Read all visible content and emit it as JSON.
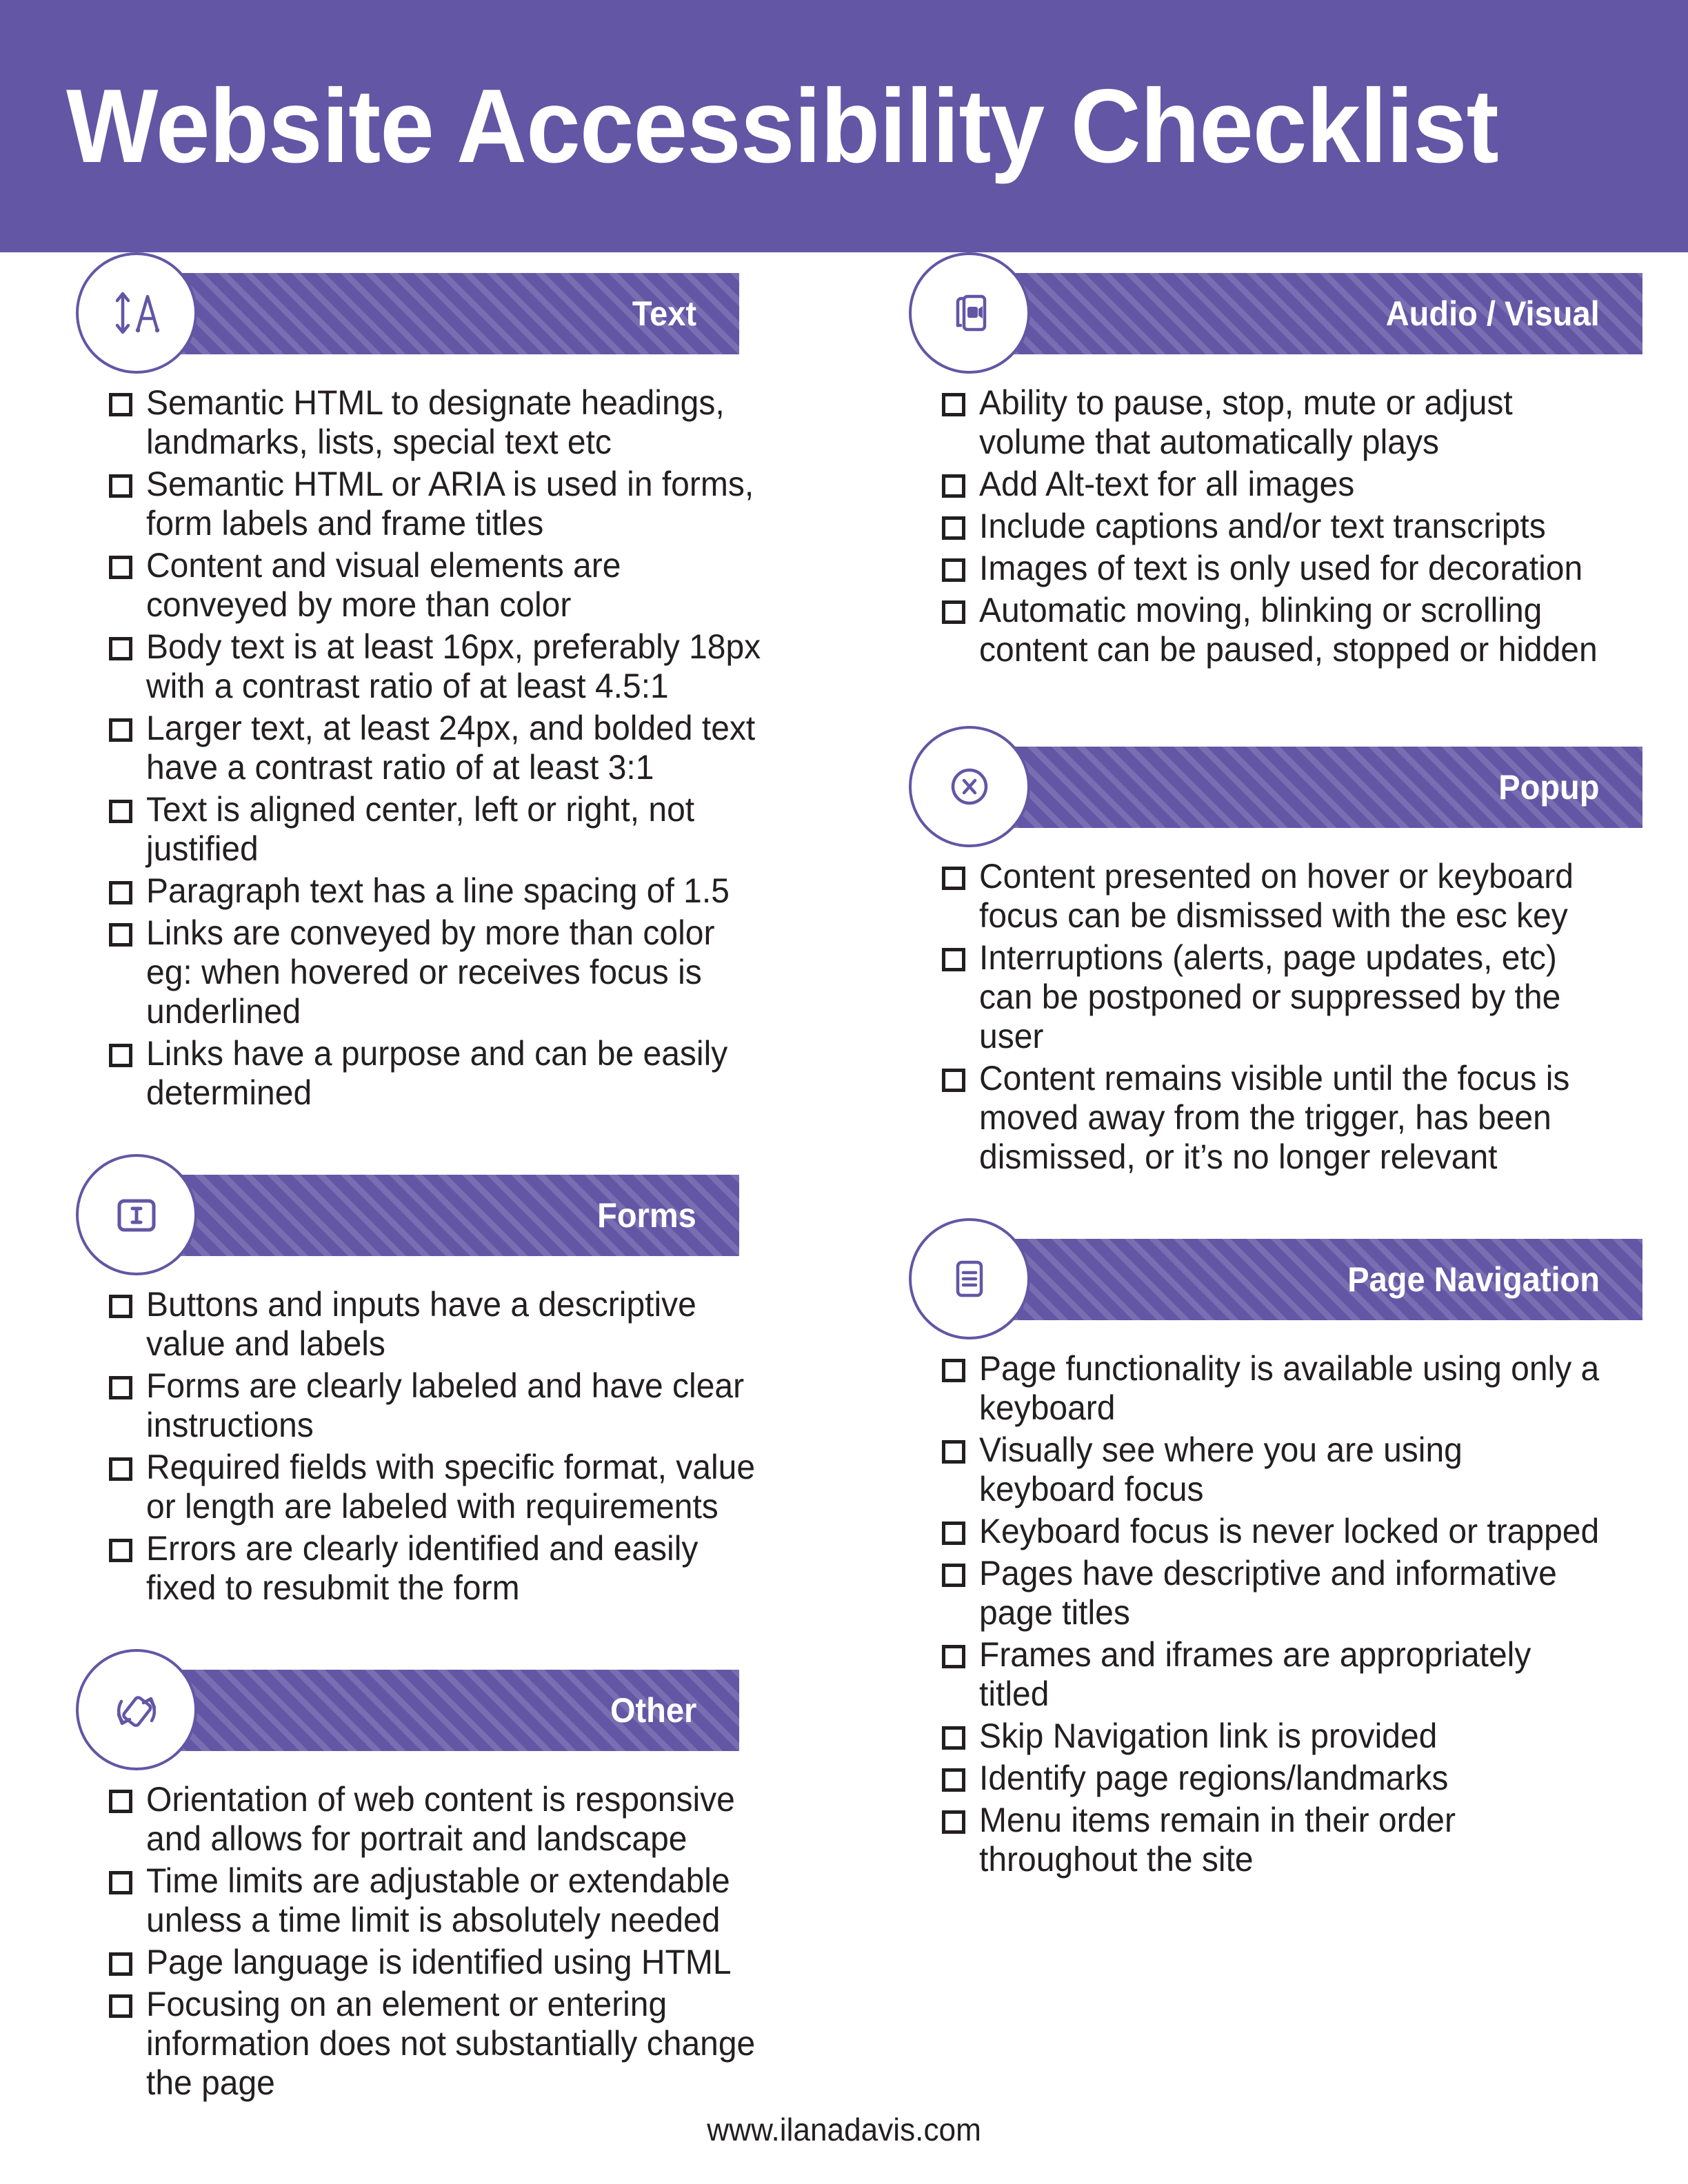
{
  "document": {
    "title": "Website Accessibility Checklist",
    "footer_url": "www.ilanadavis.com"
  },
  "theme": {
    "purple": "#6356A5",
    "ink": "#231F20",
    "white": "#FFFFFF"
  },
  "sections": {
    "text": {
      "label": "Text",
      "icon": "text-resize-icon",
      "items": [
        "Semantic HTML to designate headings, landmarks, lists, special text etc",
        "Semantic HTML or ARIA is used in forms, form labels and frame titles",
        "Content and visual elements are conveyed by more than color",
        "Body text is at least 16px, preferably 18px with a contrast ratio of at least 4.5:1",
        "Larger text, at least 24px, and bolded text have a contrast ratio of at least 3:1",
        "Text is aligned center, left or right, not justified",
        "Paragraph text has a line spacing of 1.5",
        "Links are conveyed by more than color eg: when hovered or receives focus is underlined",
        "Links have a purpose and can be easily determined"
      ]
    },
    "forms": {
      "label": "Forms",
      "icon": "text-input-field-icon",
      "items": [
        "Buttons and inputs have a descriptive value and labels",
        "Forms are clearly labeled and have clear instructions",
        "Required fields with specific format, value or length are labeled with requirements",
        "Errors are clearly identified and easily fixed to resubmit the form"
      ]
    },
    "other": {
      "label": "Other",
      "icon": "screen-rotate-icon",
      "items": [
        "Orientation of web content is responsive and allows for portrait and landscape",
        "Time limits are adjustable or extendable unless a time limit is absolutely needed",
        "Page language is identified using HTML",
        "Focusing on an element or entering information does not substantially change the page"
      ]
    },
    "audio_visual": {
      "label": "Audio / Visual",
      "icon": "video-media-icon",
      "items": [
        "Ability to pause, stop, mute or adjust volume that automatically plays",
        "Add Alt-text for all images",
        "Include captions and/or text transcripts",
        "Images of text is only used for decoration",
        "Automatic moving, blinking or scrolling content can be paused, stopped or hidden"
      ]
    },
    "popup": {
      "label": "Popup",
      "icon": "close-circle-icon",
      "items": [
        "Content presented on hover or keyboard focus can be dismissed with the esc key",
        "Interruptions (alerts, page updates, etc) can be postponed or suppressed by the user",
        "Content remains visible until the focus is moved away from the trigger, has been dismissed, or it’s no longer relevant"
      ]
    },
    "page_navigation": {
      "label": "Page Navigation",
      "icon": "menu-list-icon",
      "items": [
        "Page functionality is available using only a keyboard",
        "Visually see where you are using keyboard focus",
        "Keyboard focus is never locked or trapped",
        "Pages have descriptive and informative page titles",
        "Frames and iframes are appropriately titled",
        "Skip Navigation link is provided",
        "Identify page regions/landmarks",
        "Menu items remain in their order throughout the site"
      ]
    }
  }
}
